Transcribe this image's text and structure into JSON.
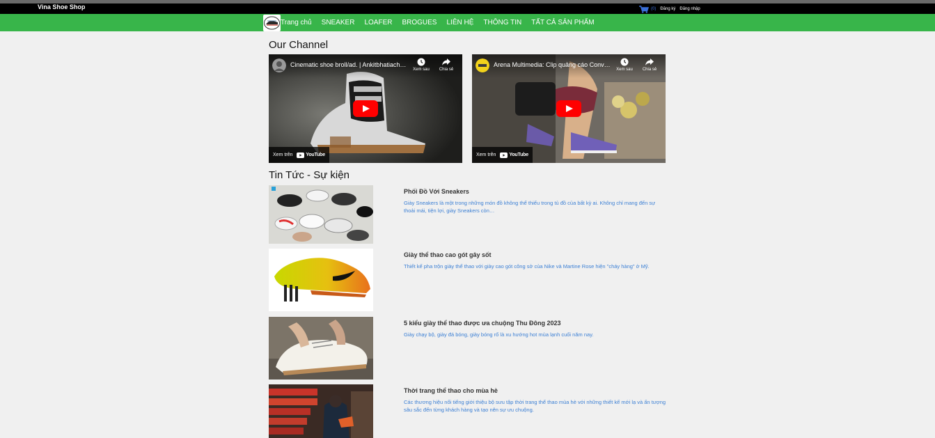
{
  "brand": "Vina Shoe Shop",
  "cart_count": "(0)",
  "auth": {
    "register": "Đăng ký",
    "login": "Đăng nhập"
  },
  "nav": [
    "Trang chủ",
    "SNEAKER",
    "LOAFER",
    "BROGUES",
    "LIÊN HỆ",
    "THÔNG TIN",
    "TẤT CẢ SẢN PHẨM"
  ],
  "channel_title": "Our Channel",
  "videos": [
    {
      "title": "Cinematic shoe broll/ad. | Ankitbhatiach…",
      "watch_later": "Xem sau",
      "share": "Chia sẻ",
      "watch_on": "Xem trên",
      "platform": "YouTube"
    },
    {
      "title": "Arena Multimedia: Clip quảng cáo Conve…",
      "watch_later": "Xem sau",
      "share": "Chia sẻ",
      "watch_on": "Xem trên",
      "platform": "YouTube"
    }
  ],
  "news_title": "Tin Tức - Sự kiện",
  "news": [
    {
      "title": "Phối Đồ Với Sneakers",
      "desc": "Giày Sneakers là một trong những món đồ không thể thiếu trong tủ đồ của bất kỳ ai. Không chỉ mang đến sự thoải mái, tiện lợi, giày Sneakers còn…"
    },
    {
      "title": "Giày thể thao cao gót gây sốt",
      "desc": "Thiết kế pha trộn giày thể thao với giày cao gót công sở của Nike và Martine Rose hiện \"cháy hàng\" ở Mỹ."
    },
    {
      "title": "5 kiểu giày thể thao được ưa chuộng Thu Đông 2023",
      "desc": "Giày chạy bộ, giày đá bóng, giày bóng rổ là xu hướng hot mùa lạnh cuối năm nay."
    },
    {
      "title": "Thời trang thể thao cho mùa hè",
      "desc": "Các thương hiệu nổi tiếng giới thiệu bộ sưu tập thời trang thể thao mùa hè với những thiết kế mới lạ và ấn tượng sâu sắc đến từng khách hàng và tạo nên sự ưu chuộng."
    }
  ],
  "colors": {
    "nav_green": "#38b54a",
    "link_blue": "#3b7fd4",
    "youtube_red": "#ff0000"
  }
}
